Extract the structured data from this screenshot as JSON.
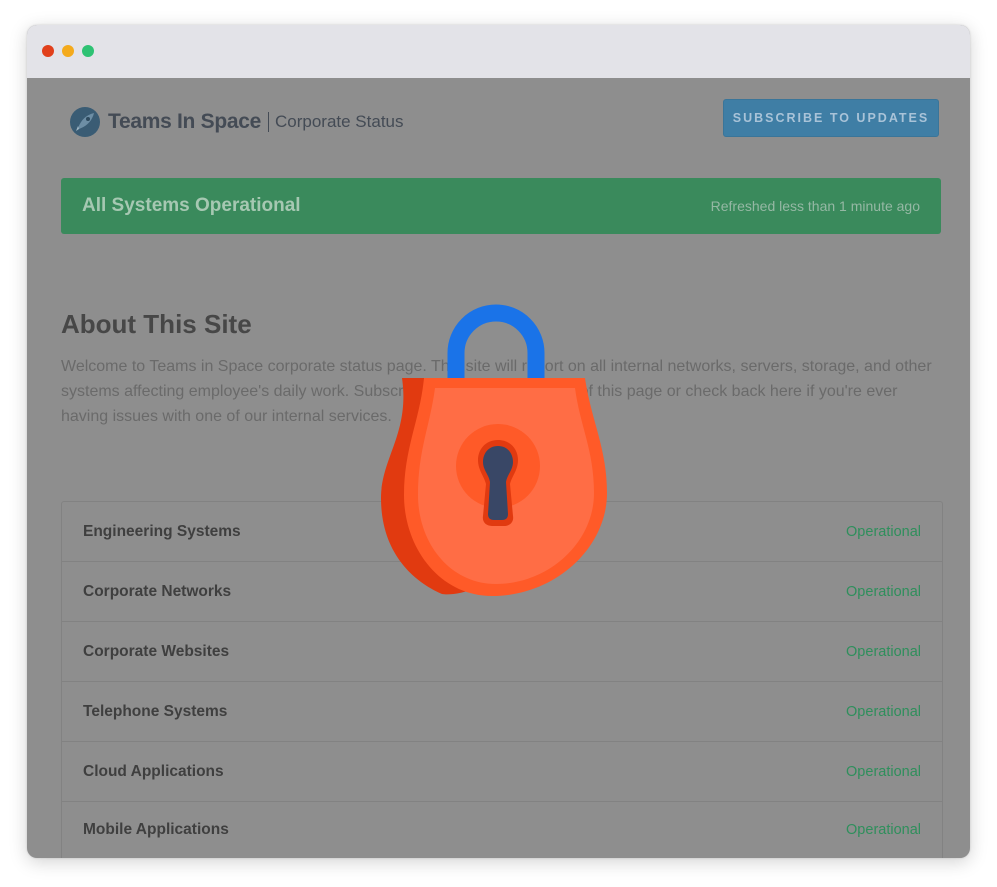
{
  "window": {
    "controls": [
      "close",
      "minimize",
      "maximize"
    ]
  },
  "header": {
    "logo_icon": "rocket-logo-icon",
    "brand_name": "Teams In Space",
    "brand_subtitle": "Corporate Status",
    "subscribe_label": "SUBSCRIBE TO UPDATES"
  },
  "status_banner": {
    "title": "All Systems Operational",
    "refreshed": "Refreshed less than 1 minute ago",
    "color": "#3a8a5c"
  },
  "about": {
    "title": "About This Site",
    "text": "Welcome to Teams in Space corporate status page. This site will report on all internal networks, servers, storage, and other systems affecting employee's daily work. Subscribe to updates at the top of this page or check back here if you're ever having issues with one of our internal services."
  },
  "components": [
    {
      "name": "Engineering Systems",
      "status": "Operational"
    },
    {
      "name": "Corporate Networks",
      "status": "Operational"
    },
    {
      "name": "Corporate Websites",
      "status": "Operational"
    },
    {
      "name": "Telephone Systems",
      "status": "Operational"
    },
    {
      "name": "Cloud Applications",
      "status": "Operational"
    },
    {
      "name": "Mobile Applications",
      "status": "Operational"
    }
  ],
  "overlay": {
    "icon": "padlock-icon",
    "colors": {
      "body": "#ff6d45",
      "shackle": "#1a73e8",
      "keyhole": "#394766"
    }
  }
}
